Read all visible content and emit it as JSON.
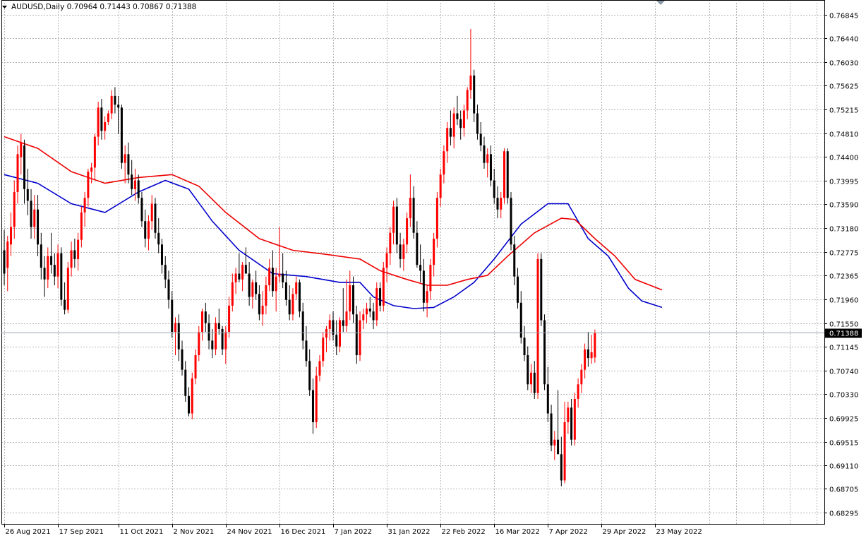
{
  "header": {
    "symbol_line": "AUDUSD,Daily  0.70964 0.71443 0.70867 0.71388"
  },
  "colors": {
    "bull": "#ff0000",
    "bear": "#000000",
    "ma_fast": "#0000cc",
    "ma_slow": "#ee0000",
    "grid": "#b4b4b4",
    "price_line": "#9aa4ae",
    "price_tag_bg": "#000000"
  },
  "chart_data": {
    "type": "candlestick",
    "title": "AUDUSD,Daily",
    "ohlc_header": {
      "open": 0.70964,
      "high": 0.71443,
      "low": 0.70867,
      "close": 0.71388
    },
    "current_price": 0.71388,
    "current_price_label": "0.71388",
    "y_range": [
      0.68092,
      0.77048
    ],
    "y_ticks": [
      "0.76845",
      "0.76440",
      "0.76030",
      "0.75625",
      "0.75215",
      "0.74810",
      "0.74400",
      "0.73995",
      "0.73590",
      "0.73180",
      "0.72775",
      "0.72365",
      "0.71960",
      "0.71550",
      "0.71145",
      "0.70740",
      "0.70330",
      "0.69925",
      "0.69515",
      "0.69110",
      "0.68705",
      "0.68295"
    ],
    "x_ticks": [
      {
        "index": 0,
        "label": "26 Aug 2021"
      },
      {
        "index": 16,
        "label": "17 Sep 2021"
      },
      {
        "index": 34,
        "label": "11 Oct 2021"
      },
      {
        "index": 50,
        "label": "2 Nov 2021"
      },
      {
        "index": 66,
        "label": "24 Nov 2021"
      },
      {
        "index": 82,
        "label": "16 Dec 2021"
      },
      {
        "index": 98,
        "label": "7 Jan 2022"
      },
      {
        "index": 114,
        "label": "31 Jan 2022"
      },
      {
        "index": 130,
        "label": "22 Feb 2022"
      },
      {
        "index": 146,
        "label": "16 Mar 2022"
      },
      {
        "index": 162,
        "label": "7 Apr 2022"
      },
      {
        "index": 178,
        "label": "29 Apr 2022"
      },
      {
        "index": 194,
        "label": "23 May 2022"
      }
    ],
    "grid": true,
    "series": [
      {
        "type": "moving_average",
        "color": "#0000cc",
        "points": [
          [
            0,
            0.741
          ],
          [
            10,
            0.7395
          ],
          [
            20,
            0.736
          ],
          [
            30,
            0.7345
          ],
          [
            40,
            0.738
          ],
          [
            48,
            0.74
          ],
          [
            55,
            0.7385
          ],
          [
            62,
            0.733
          ],
          [
            70,
            0.728
          ],
          [
            80,
            0.724
          ],
          [
            90,
            0.7235
          ],
          [
            100,
            0.7225
          ],
          [
            106,
            0.7225
          ],
          [
            110,
            0.72
          ],
          [
            116,
            0.7185
          ],
          [
            122,
            0.718
          ],
          [
            128,
            0.7182
          ],
          [
            134,
            0.72
          ],
          [
            140,
            0.7225
          ],
          [
            146,
            0.7265
          ],
          [
            154,
            0.7325
          ],
          [
            162,
            0.736
          ],
          [
            168,
            0.736
          ],
          [
            174,
            0.73
          ],
          [
            180,
            0.727
          ],
          [
            186,
            0.7215
          ],
          [
            190,
            0.7193
          ],
          [
            196,
            0.7182
          ]
        ]
      },
      {
        "type": "moving_average",
        "color": "#ee0000",
        "points": [
          [
            0,
            0.7475
          ],
          [
            10,
            0.7455
          ],
          [
            20,
            0.7415
          ],
          [
            30,
            0.7395
          ],
          [
            40,
            0.7405
          ],
          [
            50,
            0.741
          ],
          [
            58,
            0.739
          ],
          [
            66,
            0.7345
          ],
          [
            76,
            0.73
          ],
          [
            86,
            0.728
          ],
          [
            96,
            0.7273
          ],
          [
            106,
            0.7265
          ],
          [
            112,
            0.7245
          ],
          [
            120,
            0.723
          ],
          [
            126,
            0.722
          ],
          [
            132,
            0.722
          ],
          [
            138,
            0.723
          ],
          [
            144,
            0.7237
          ],
          [
            150,
            0.727
          ],
          [
            158,
            0.731
          ],
          [
            166,
            0.7335
          ],
          [
            170,
            0.7333
          ],
          [
            176,
            0.73
          ],
          [
            182,
            0.727
          ],
          [
            188,
            0.723
          ],
          [
            196,
            0.7212
          ]
        ]
      }
    ],
    "candles": [
      [
        0.728,
        0.7315,
        0.722,
        0.724
      ],
      [
        0.725,
        0.7305,
        0.721,
        0.7295
      ],
      [
        0.729,
        0.7345,
        0.727,
        0.732
      ],
      [
        0.732,
        0.74,
        0.73,
        0.738
      ],
      [
        0.738,
        0.746,
        0.736,
        0.7445
      ],
      [
        0.744,
        0.748,
        0.741,
        0.7465
      ],
      [
        0.746,
        0.747,
        0.736,
        0.7385
      ],
      [
        0.7385,
        0.742,
        0.734,
        0.7365
      ],
      [
        0.7365,
        0.7385,
        0.73,
        0.732
      ],
      [
        0.732,
        0.7375,
        0.73,
        0.735
      ],
      [
        0.735,
        0.7375,
        0.727,
        0.729
      ],
      [
        0.729,
        0.731,
        0.723,
        0.725
      ],
      [
        0.725,
        0.727,
        0.72,
        0.723
      ],
      [
        0.723,
        0.7285,
        0.7215,
        0.727
      ],
      [
        0.727,
        0.731,
        0.724,
        0.7255
      ],
      [
        0.7255,
        0.7275,
        0.722,
        0.7235
      ],
      [
        0.7235,
        0.729,
        0.7215,
        0.7275
      ],
      [
        0.7275,
        0.7285,
        0.7185,
        0.7195
      ],
      [
        0.7195,
        0.7225,
        0.717,
        0.7178
      ],
      [
        0.7178,
        0.726,
        0.7172,
        0.725
      ],
      [
        0.725,
        0.7295,
        0.7235,
        0.728
      ],
      [
        0.728,
        0.73,
        0.725,
        0.7265
      ],
      [
        0.7265,
        0.731,
        0.7245,
        0.7298
      ],
      [
        0.7298,
        0.7355,
        0.7285,
        0.7345
      ],
      [
        0.7345,
        0.738,
        0.732,
        0.737
      ],
      [
        0.737,
        0.742,
        0.7355,
        0.7415
      ],
      [
        0.7415,
        0.743,
        0.7395,
        0.7422
      ],
      [
        0.7422,
        0.748,
        0.74,
        0.7475
      ],
      [
        0.7475,
        0.7535,
        0.746,
        0.7525
      ],
      [
        0.7525,
        0.754,
        0.747,
        0.7485
      ],
      [
        0.7485,
        0.751,
        0.747,
        0.75
      ],
      [
        0.75,
        0.752,
        0.7495,
        0.7515
      ],
      [
        0.7515,
        0.7555,
        0.7505,
        0.7545
      ],
      [
        0.7545,
        0.756,
        0.7515,
        0.753
      ],
      [
        0.753,
        0.7545,
        0.748,
        0.7525
      ],
      [
        0.7525,
        0.753,
        0.742,
        0.743
      ],
      [
        0.743,
        0.746,
        0.7395,
        0.7445
      ],
      [
        0.7445,
        0.7465,
        0.7395,
        0.741
      ],
      [
        0.741,
        0.7435,
        0.7375,
        0.7385
      ],
      [
        0.7385,
        0.742,
        0.7365,
        0.74
      ],
      [
        0.74,
        0.741,
        0.736,
        0.737
      ],
      [
        0.737,
        0.738,
        0.732,
        0.733
      ],
      [
        0.733,
        0.735,
        0.7285,
        0.73
      ],
      [
        0.73,
        0.734,
        0.728,
        0.733
      ],
      [
        0.733,
        0.7375,
        0.7315,
        0.736
      ],
      [
        0.736,
        0.737,
        0.73,
        0.731
      ],
      [
        0.731,
        0.7335,
        0.7275,
        0.729
      ],
      [
        0.729,
        0.73,
        0.724,
        0.7255
      ],
      [
        0.7255,
        0.727,
        0.7215,
        0.723
      ],
      [
        0.723,
        0.7245,
        0.718,
        0.7195
      ],
      [
        0.7195,
        0.721,
        0.713,
        0.714
      ],
      [
        0.714,
        0.7165,
        0.71,
        0.7155
      ],
      [
        0.7155,
        0.717,
        0.709,
        0.711
      ],
      [
        0.711,
        0.7125,
        0.7065,
        0.7075
      ],
      [
        0.7075,
        0.709,
        0.702,
        0.703
      ],
      [
        0.703,
        0.7045,
        0.6995,
        0.7
      ],
      [
        0.7,
        0.707,
        0.699,
        0.706
      ],
      [
        0.706,
        0.711,
        0.705,
        0.71
      ],
      [
        0.71,
        0.715,
        0.709,
        0.714
      ],
      [
        0.714,
        0.718,
        0.7125,
        0.7175
      ],
      [
        0.7175,
        0.719,
        0.714,
        0.7155
      ],
      [
        0.7155,
        0.717,
        0.711,
        0.7125
      ],
      [
        0.7125,
        0.7145,
        0.7095,
        0.711
      ],
      [
        0.711,
        0.7165,
        0.71,
        0.7155
      ],
      [
        0.7155,
        0.718,
        0.7135,
        0.7145
      ],
      [
        0.7145,
        0.715,
        0.71,
        0.711
      ],
      [
        0.711,
        0.715,
        0.7085,
        0.714
      ],
      [
        0.714,
        0.72,
        0.713,
        0.7185
      ],
      [
        0.7185,
        0.724,
        0.7175,
        0.7225
      ],
      [
        0.7225,
        0.725,
        0.7205,
        0.724
      ],
      [
        0.724,
        0.7275,
        0.7225,
        0.723
      ],
      [
        0.723,
        0.726,
        0.721,
        0.7255
      ],
      [
        0.7255,
        0.7285,
        0.724,
        0.724
      ],
      [
        0.724,
        0.726,
        0.7185,
        0.72
      ],
      [
        0.72,
        0.723,
        0.718,
        0.7225
      ],
      [
        0.7225,
        0.7245,
        0.7195,
        0.7205
      ],
      [
        0.7205,
        0.722,
        0.716,
        0.717
      ],
      [
        0.717,
        0.721,
        0.715,
        0.7185
      ],
      [
        0.7185,
        0.7235,
        0.717,
        0.722
      ],
      [
        0.722,
        0.7265,
        0.721,
        0.725
      ],
      [
        0.725,
        0.728,
        0.72,
        0.721
      ],
      [
        0.721,
        0.725,
        0.7175,
        0.7235
      ],
      [
        0.7235,
        0.732,
        0.7225,
        0.724
      ],
      [
        0.724,
        0.7275,
        0.7215,
        0.7225
      ],
      [
        0.7225,
        0.7245,
        0.7185,
        0.7195
      ],
      [
        0.7195,
        0.722,
        0.716,
        0.717
      ],
      [
        0.717,
        0.7215,
        0.716,
        0.7205
      ],
      [
        0.7205,
        0.7235,
        0.7195,
        0.7225
      ],
      [
        0.7225,
        0.723,
        0.7165,
        0.7175
      ],
      [
        0.7175,
        0.719,
        0.711,
        0.7125
      ],
      [
        0.7125,
        0.715,
        0.708,
        0.709
      ],
      [
        0.709,
        0.711,
        0.703,
        0.704
      ],
      [
        0.704,
        0.706,
        0.6965,
        0.6985
      ],
      [
        0.6985,
        0.708,
        0.6975,
        0.7065
      ],
      [
        0.7065,
        0.71,
        0.7055,
        0.709
      ],
      [
        0.709,
        0.714,
        0.708,
        0.713
      ],
      [
        0.713,
        0.715,
        0.7105,
        0.7145
      ],
      [
        0.7145,
        0.717,
        0.7125,
        0.716
      ],
      [
        0.716,
        0.7175,
        0.7125,
        0.7135
      ],
      [
        0.7135,
        0.716,
        0.71,
        0.7115
      ],
      [
        0.7115,
        0.7165,
        0.7105,
        0.716
      ],
      [
        0.716,
        0.7215,
        0.714,
        0.715
      ],
      [
        0.715,
        0.723,
        0.714,
        0.7175
      ],
      [
        0.7175,
        0.7245,
        0.716,
        0.722
      ],
      [
        0.722,
        0.7235,
        0.7155,
        0.717
      ],
      [
        0.717,
        0.7185,
        0.7085,
        0.71
      ],
      [
        0.71,
        0.7175,
        0.709,
        0.716
      ],
      [
        0.716,
        0.718,
        0.7145,
        0.717
      ],
      [
        0.717,
        0.719,
        0.7155,
        0.718
      ],
      [
        0.718,
        0.72,
        0.7165,
        0.7175
      ],
      [
        0.7175,
        0.719,
        0.7145,
        0.716
      ],
      [
        0.716,
        0.7225,
        0.715,
        0.7215
      ],
      [
        0.7215,
        0.7225,
        0.7175,
        0.7185
      ],
      [
        0.7185,
        0.726,
        0.7175,
        0.725
      ],
      [
        0.725,
        0.7285,
        0.7225,
        0.7275
      ],
      [
        0.7275,
        0.732,
        0.7255,
        0.731
      ],
      [
        0.731,
        0.7365,
        0.729,
        0.7355
      ],
      [
        0.7355,
        0.737,
        0.7275,
        0.729
      ],
      [
        0.729,
        0.731,
        0.725,
        0.7265
      ],
      [
        0.7265,
        0.73,
        0.7245,
        0.729
      ],
      [
        0.729,
        0.7345,
        0.7275,
        0.7335
      ],
      [
        0.7335,
        0.741,
        0.732,
        0.737
      ],
      [
        0.737,
        0.739,
        0.73,
        0.731
      ],
      [
        0.731,
        0.733,
        0.725,
        0.7255
      ],
      [
        0.7255,
        0.729,
        0.7225,
        0.7245
      ],
      [
        0.7245,
        0.7265,
        0.7175,
        0.719
      ],
      [
        0.719,
        0.722,
        0.7165,
        0.721
      ],
      [
        0.721,
        0.7265,
        0.7195,
        0.7255
      ],
      [
        0.7255,
        0.731,
        0.7235,
        0.73
      ],
      [
        0.73,
        0.738,
        0.7285,
        0.737
      ],
      [
        0.737,
        0.742,
        0.7355,
        0.741
      ],
      [
        0.741,
        0.746,
        0.7395,
        0.745
      ],
      [
        0.745,
        0.75,
        0.743,
        0.749
      ],
      [
        0.749,
        0.752,
        0.746,
        0.7475
      ],
      [
        0.7475,
        0.7525,
        0.7455,
        0.7515
      ],
      [
        0.7515,
        0.7545,
        0.7495,
        0.7505
      ],
      [
        0.7505,
        0.752,
        0.747,
        0.749
      ],
      [
        0.749,
        0.753,
        0.7475,
        0.752
      ],
      [
        0.752,
        0.756,
        0.7505,
        0.7555
      ],
      [
        0.7555,
        0.766,
        0.754,
        0.758
      ],
      [
        0.758,
        0.759,
        0.75,
        0.7515
      ],
      [
        0.7515,
        0.753,
        0.747,
        0.748
      ],
      [
        0.748,
        0.75,
        0.745,
        0.746
      ],
      [
        0.746,
        0.7475,
        0.742,
        0.743
      ],
      [
        0.743,
        0.7455,
        0.7405,
        0.7445
      ],
      [
        0.7445,
        0.746,
        0.739,
        0.74
      ],
      [
        0.74,
        0.742,
        0.736,
        0.737
      ],
      [
        0.737,
        0.739,
        0.7335,
        0.735
      ],
      [
        0.735,
        0.738,
        0.7335,
        0.737
      ],
      [
        0.737,
        0.7455,
        0.736,
        0.745
      ],
      [
        0.745,
        0.7455,
        0.736,
        0.737
      ],
      [
        0.737,
        0.738,
        0.728,
        0.729
      ],
      [
        0.729,
        0.7305,
        0.722,
        0.7235
      ],
      [
        0.7235,
        0.725,
        0.718,
        0.719
      ],
      [
        0.719,
        0.721,
        0.712,
        0.713
      ],
      [
        0.713,
        0.715,
        0.709,
        0.71
      ],
      [
        0.71,
        0.7115,
        0.704,
        0.705
      ],
      [
        0.705,
        0.7085,
        0.7035,
        0.707
      ],
      [
        0.707,
        0.709,
        0.7025,
        0.7035
      ],
      [
        0.7035,
        0.7275,
        0.7025,
        0.7265
      ],
      [
        0.7265,
        0.7275,
        0.715,
        0.716
      ],
      [
        0.716,
        0.717,
        0.704,
        0.705
      ],
      [
        0.705,
        0.708,
        0.6985,
        0.7
      ],
      [
        0.7,
        0.7015,
        0.6935,
        0.6945
      ],
      [
        0.6945,
        0.697,
        0.692,
        0.6955
      ],
      [
        0.6955,
        0.704,
        0.694,
        0.693
      ],
      [
        0.693,
        0.696,
        0.6875,
        0.6885
      ],
      [
        0.6885,
        0.702,
        0.688,
        0.6985
      ],
      [
        0.6985,
        0.702,
        0.6965,
        0.701
      ],
      [
        0.701,
        0.7025,
        0.6945,
        0.6955
      ],
      [
        0.6955,
        0.7035,
        0.6945,
        0.7025
      ],
      [
        0.7025,
        0.706,
        0.701,
        0.705
      ],
      [
        0.705,
        0.7085,
        0.7035,
        0.7075
      ],
      [
        0.7075,
        0.712,
        0.706,
        0.711
      ],
      [
        0.711,
        0.714,
        0.708,
        0.7095
      ],
      [
        0.7095,
        0.7135,
        0.7085,
        0.7105
      ],
      [
        0.7096,
        0.7144,
        0.7087,
        0.7139
      ]
    ]
  }
}
